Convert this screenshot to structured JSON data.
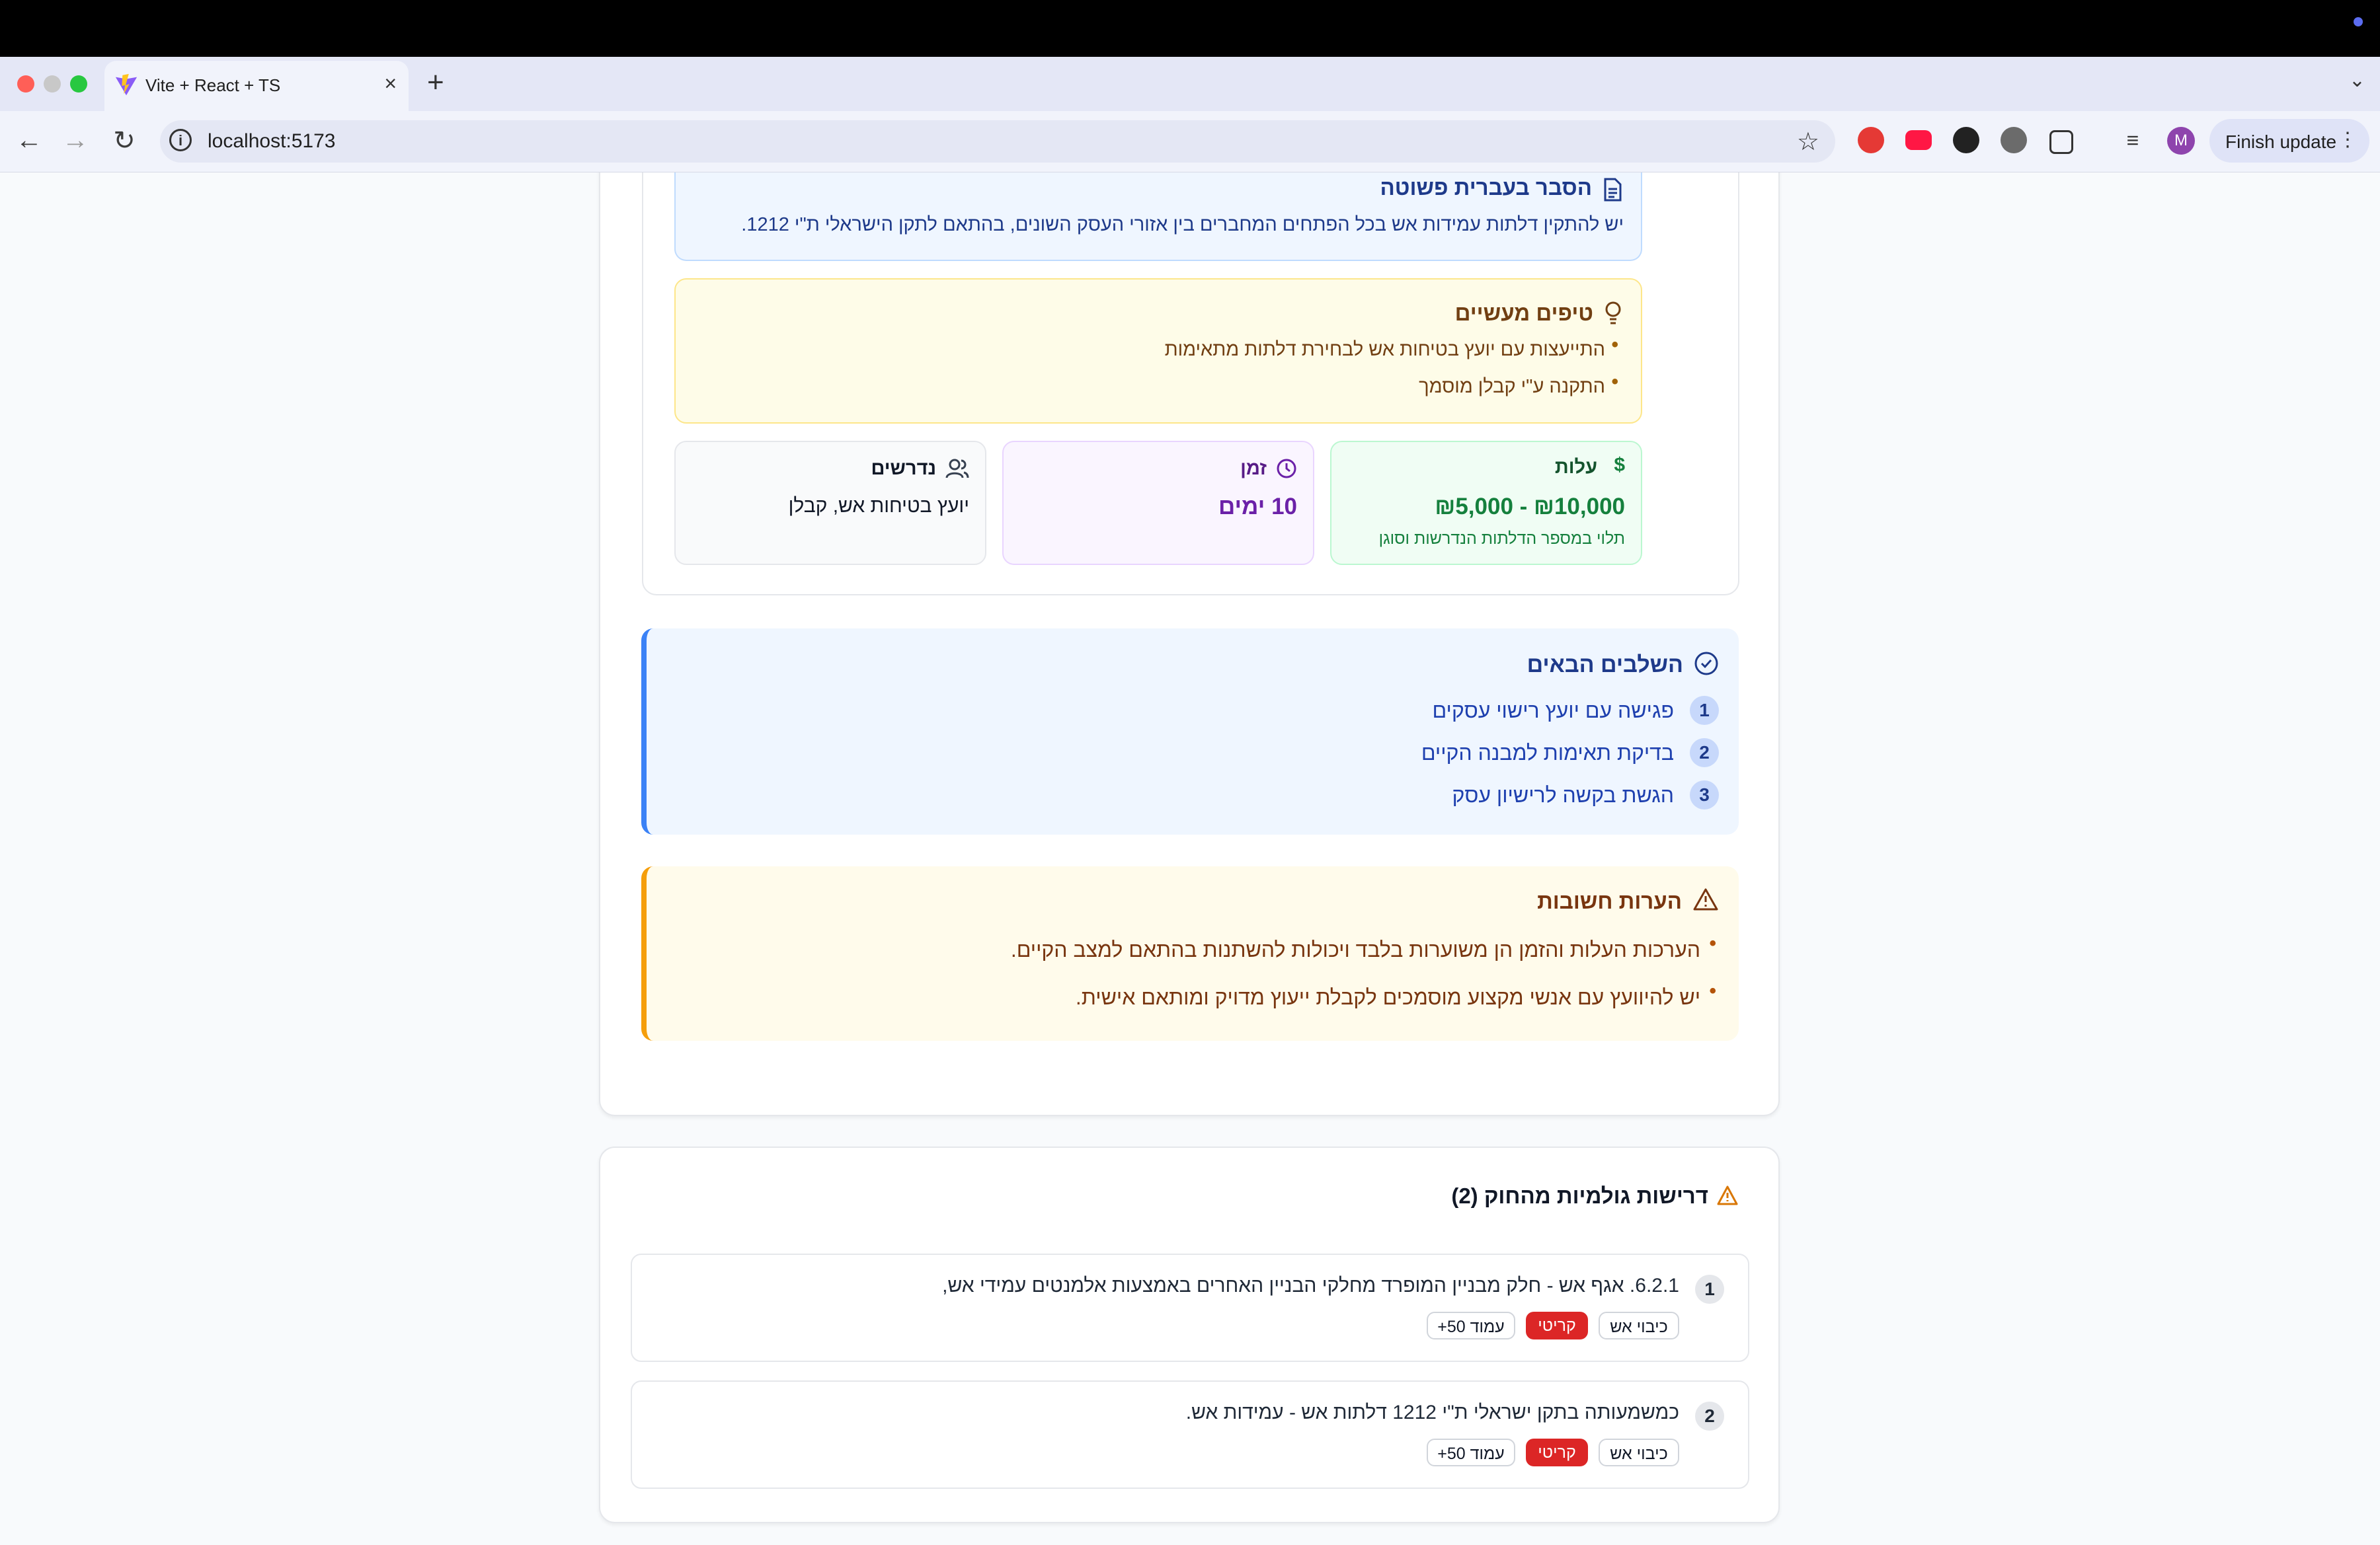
{
  "browser": {
    "tab_title": "Vite + React + TS",
    "new_tab": "+",
    "url": "localhost:5173",
    "update_label": "Finish update",
    "avatar_letter": "M"
  },
  "explanation": {
    "title": "הסבר בעברית פשוטה",
    "text": "יש להתקין דלתות עמידות אש בכל הפתחים המחברים בין אזורי העסק השונים, בהתאם לתקן הישראלי ת\"י 1212."
  },
  "tips": {
    "title": "טיפים מעשיים",
    "items": [
      "התייעצות עם יועץ בטיחות אש לבחירת דלתות מתאימות",
      "התקנה ע\"י קבלן מוסמך"
    ]
  },
  "stats": {
    "cost": {
      "label": "עלות",
      "value": "₪5,000 - ₪10,000",
      "note": "תלוי במספר הדלתות הנדרשות וסוגן"
    },
    "time": {
      "label": "זמן",
      "value": "10 ימים"
    },
    "required": {
      "label": "נדרשים",
      "value": "יועץ בטיחות אש, קבלן"
    }
  },
  "next_steps": {
    "title": "השלבים הבאים",
    "items": [
      {
        "num": "1",
        "text": "פגישה עם יועץ רישוי עסקים"
      },
      {
        "num": "2",
        "text": "בדיקת תאימות למבנה הקיים"
      },
      {
        "num": "3",
        "text": "הגשת בקשה לרישיון עסק"
      }
    ]
  },
  "notes": {
    "title": "הערות חשובות",
    "items": [
      "הערכות העלות והזמן הן משוערות בלבד ויכולות להשתנות בהתאם למצב הקיים.",
      "יש להיוועץ עם אנשי מקצוע מוסמכים לקבלת ייעוץ מדויק ומותאם אישית."
    ]
  },
  "requirements": {
    "title": "דרישות גולמיות מהחוק (2)",
    "items": [
      {
        "num": "1",
        "text": "6.2.1. אגף אש - חלק מבניין המופרד מחלקי הבניין האחרים באמצעות אלמנטים עמידי אש,",
        "tags": [
          "כיבוי אש",
          "קריטי",
          "עמוד 50+"
        ]
      },
      {
        "num": "2",
        "text": "כמשמעותה בתקן ישראלי ת\"י 1212 דלתות אש - עמידות אש.",
        "tags": [
          "כיבוי אש",
          "קריטי",
          "עמוד 50+"
        ]
      }
    ]
  },
  "colors": {
    "accent_blue": "#3b82f6",
    "warning_orange": "#f59e0b",
    "critical_red": "#dc2626",
    "cost_green": "#15803d",
    "time_purple": "#6b21a8"
  }
}
